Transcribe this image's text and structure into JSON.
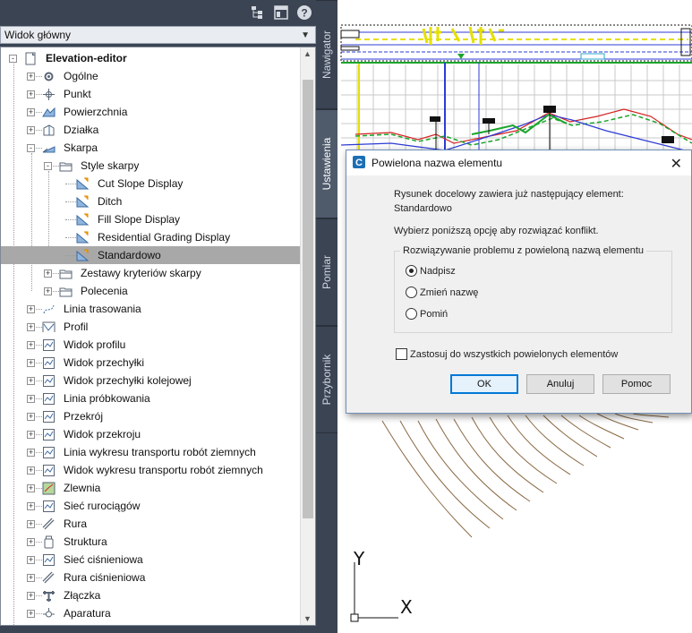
{
  "palette": {
    "view_selector": "Widok główny",
    "tree": [
      {
        "label": "Elevation-editor",
        "bold": true
      },
      {
        "label": "Ogólne"
      },
      {
        "label": "Punkt"
      },
      {
        "label": "Powierzchnia"
      },
      {
        "label": "Działka"
      },
      {
        "label": "Skarpa"
      },
      {
        "label": "Style skarpy"
      },
      {
        "label": "Cut Slope Display"
      },
      {
        "label": "Ditch"
      },
      {
        "label": "Fill Slope Display"
      },
      {
        "label": "Residential Grading Display"
      },
      {
        "label": "Standardowo",
        "selected": true
      },
      {
        "label": "Zestawy kryteriów skarpy"
      },
      {
        "label": "Polecenia"
      },
      {
        "label": "Linia trasowania"
      },
      {
        "label": "Profil"
      },
      {
        "label": "Widok profilu"
      },
      {
        "label": "Widok przechyłki"
      },
      {
        "label": "Widok przechyłki kolejowej"
      },
      {
        "label": "Linia próbkowania"
      },
      {
        "label": "Przekrój"
      },
      {
        "label": "Widok przekroju"
      },
      {
        "label": "Linia wykresu transportu robót ziemnych"
      },
      {
        "label": "Widok wykresu transportu robót ziemnych"
      },
      {
        "label": "Zlewnia"
      },
      {
        "label": "Sieć rurociągów"
      },
      {
        "label": "Rura"
      },
      {
        "label": "Struktura"
      },
      {
        "label": "Sieć ciśnieniowa"
      },
      {
        "label": "Rura ciśnieniowa"
      },
      {
        "label": "Złączka"
      },
      {
        "label": "Aparatura"
      }
    ],
    "icons": [
      "tree-view-icon",
      "properties-icon",
      "help-icon"
    ]
  },
  "side_tabs": [
    "Nawigator",
    "Ustawienia",
    "Pomiar",
    "Przybornik"
  ],
  "active_tab": "Ustawienia",
  "dialog": {
    "title": "Powielona nazwa elementu",
    "message_line1": "Rysunek docelowy zawiera już następujący element:",
    "element_name": "Standardowo",
    "instruction": "Wybierz poniższą opcję aby rozwiązać konflikt.",
    "group_label": "Rozwiązywanie problemu z powieloną nazwą elementu",
    "options": [
      "Nadpisz",
      "Zmień nazwę",
      "Pomiń"
    ],
    "selected_option": "Nadpisz",
    "apply_all_label": "Zastosuj do wszystkich powielonych elementów",
    "apply_all_checked": false,
    "buttons": {
      "ok": "OK",
      "cancel": "Anuluj",
      "help": "Pomoc"
    }
  },
  "ucs": {
    "y_label": "Y",
    "x_label": "X"
  },
  "colors": {
    "accent": "#0078d7",
    "panel_bg": "#3b4453",
    "selection": "#a8a8a8"
  }
}
